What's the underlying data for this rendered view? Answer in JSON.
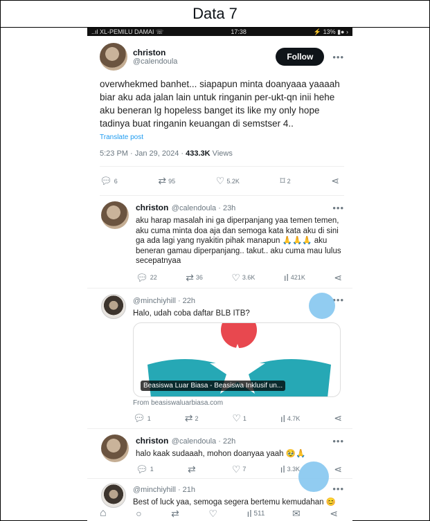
{
  "header": {
    "title": "Data 7"
  },
  "statusbar": {
    "carrier": "..ıl XL-PEMILU DAMAI ☏",
    "time": "17:38",
    "battery": "⚡ 13% ▮● ›"
  },
  "main_post": {
    "name": "christon",
    "handle": "@calendoula",
    "follow_label": "Follow",
    "more": "•••",
    "text": "overwhekmed banhet... siapapun minta doanyaaa yaaaah biar aku ada jalan lain untuk ringanin per-ukt-qn inii hehe aku beneran lg hopeless banget its like my only hope tadinya buat ringanin keuangan di semstser 4..",
    "translate": "Translate post",
    "meta_time": "5:23 PM · Jan 29, 2024 · ",
    "views_count": "433.3K",
    "views_label": " Views",
    "actions": {
      "replies": "6",
      "reposts": "95",
      "likes": "5.2K",
      "bookmarks": "2"
    }
  },
  "replies": [
    {
      "name": "christon",
      "handle": "@calendoula · 23h",
      "more": "•••",
      "text": "aku harap masalah ini ga diperpanjang yaa temen temen, aku cuma minta doa aja dan semoga kata kata aku di sini ga ada lagi yang nyakitin pihak manapun 🙏🙏🙏 aku beneran gamau diperpanjang.. takut.. aku cuma mau lulus secepatnyaa",
      "stats": {
        "replies": "22",
        "reposts": "36",
        "likes": "3.6K",
        "views": "421K"
      }
    },
    {
      "name": "",
      "handle": "@minchiyhill · 22h",
      "more": "•••",
      "text": "Halo, udah coba daftar BLB ITB?",
      "card_title": "Beasiswa Luar Biasa - Beasiswa Inklusif un...",
      "card_from": "From beasiswaluarbiasa.com",
      "stats": {
        "replies": "1",
        "reposts": "2",
        "likes": "1",
        "views": "4.7K"
      }
    },
    {
      "name": "christon",
      "handle": "@calendoula · 22h",
      "more": "•••",
      "text": "halo kaak sudaaah, mohon doanyaa yaah 🥹🙏",
      "stats": {
        "replies": "1",
        "reposts": "",
        "likes": "7",
        "views": "3.3K"
      }
    },
    {
      "name": "",
      "handle": "@minchiyhill · 21h",
      "more": "•••",
      "text": "Best of luck yaa, semoga segera bertemu kemudahan 😊",
      "stats": {
        "views": "511"
      }
    }
  ],
  "colors": {
    "accent": "#1d9bf0",
    "star_red": "#e8484f",
    "star_teal": "#26a8b5"
  }
}
